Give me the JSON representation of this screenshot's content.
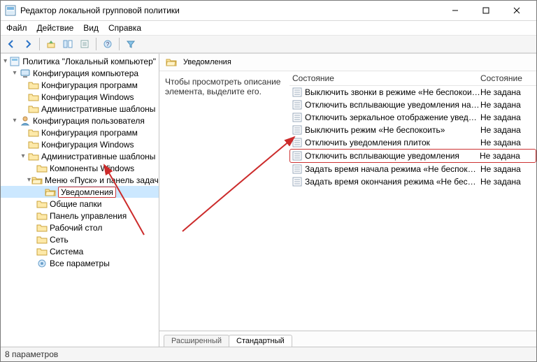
{
  "window": {
    "title": "Редактор локальной групповой политики"
  },
  "menu": {
    "file": "Файл",
    "action": "Действие",
    "view": "Вид",
    "help": "Справка"
  },
  "tree": {
    "root": "Политика \"Локальный компьютер\"",
    "compCfg": "Конфигурация компьютера",
    "compSoft": "Конфигурация программ",
    "compWin": "Конфигурация Windows",
    "compAdmin": "Административные шаблоны",
    "userCfg": "Конфигурация пользователя",
    "userSoft": "Конфигурация программ",
    "userWin": "Конфигурация Windows",
    "userAdmin": "Административные шаблоны",
    "winComp": "Компоненты Windows",
    "startMenu": "Меню «Пуск» и панель задач",
    "notifications": "Уведомления",
    "sharedFolders": "Общие папки",
    "controlPanel": "Панель управления",
    "desktop": "Рабочий стол",
    "network": "Сеть",
    "system": "Система",
    "allSettings": "Все параметры"
  },
  "content": {
    "header": "Уведомления",
    "desc": "Чтобы просмотреть описание элемента, выделите его.",
    "colName": "Состояние",
    "colState": "Состояние",
    "stateNotSet": "Не задана",
    "items": [
      "Выключить звонки в режиме «Не беспокоить»",
      "Отключить всплывающие уведомления на экране блоки...",
      "Отключить зеркальное отображение уведомлений",
      "Выключить режим «Не беспокоить»",
      "Отключить уведомления плиток",
      "Отключить всплывающие уведомления",
      "Задать время начала режима «Не беспокоить» каждый д...",
      "Задать время окончания режима «Не беспокоить» кажд..."
    ]
  },
  "tabs": {
    "extended": "Расширенный",
    "standard": "Стандартный"
  },
  "status": "8 параметров"
}
